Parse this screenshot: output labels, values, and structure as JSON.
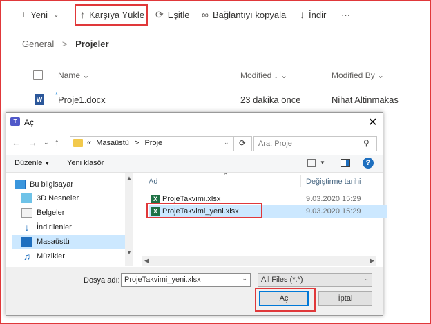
{
  "toolbar": {
    "new_label": "Yeni",
    "upload_label": "Karşıya Yükle",
    "sync_label": "Eşitle",
    "copy_link_label": "Bağlantıyı kopyala",
    "download_label": "İndir",
    "more_label": "···"
  },
  "breadcrumb": {
    "parent": "General",
    "separator": ">",
    "current": "Projeler"
  },
  "columns": {
    "name": "Name",
    "modified": "Modified",
    "modified_by": "Modified By"
  },
  "files": [
    {
      "name": "Proje1.docx",
      "modified": "23 dakika önce",
      "modified_by": "Nihat Altinmakas"
    }
  ],
  "dialog": {
    "title": "Aç",
    "path": {
      "prefix": "«",
      "seg1": "Masaüstü",
      "sep": ">",
      "seg2": "Proje"
    },
    "search_placeholder": "Ara: Proje",
    "organize_label": "Düzenle",
    "new_folder_label": "Yeni klasör",
    "nav_items": [
      "Bu bilgisayar",
      "3D Nesneler",
      "Belgeler",
      "İndirilenler",
      "Masaüstü",
      "Müzikler"
    ],
    "list_headers": {
      "name": "Ad",
      "date": "Değiştirme tarihi"
    },
    "list_files": [
      {
        "name": "ProjeTakvimi.xlsx",
        "date": "9.03.2020 15:29"
      },
      {
        "name": "ProjeTakvimi_yeni.xlsx",
        "date": "9.03.2020 15:29"
      }
    ],
    "filename_label": "Dosya adı:",
    "filename_value": "ProjeTakvimi_yeni.xlsx",
    "filter_value": "All Files (*.*)",
    "open_label": "Aç",
    "cancel_label": "İptal"
  }
}
